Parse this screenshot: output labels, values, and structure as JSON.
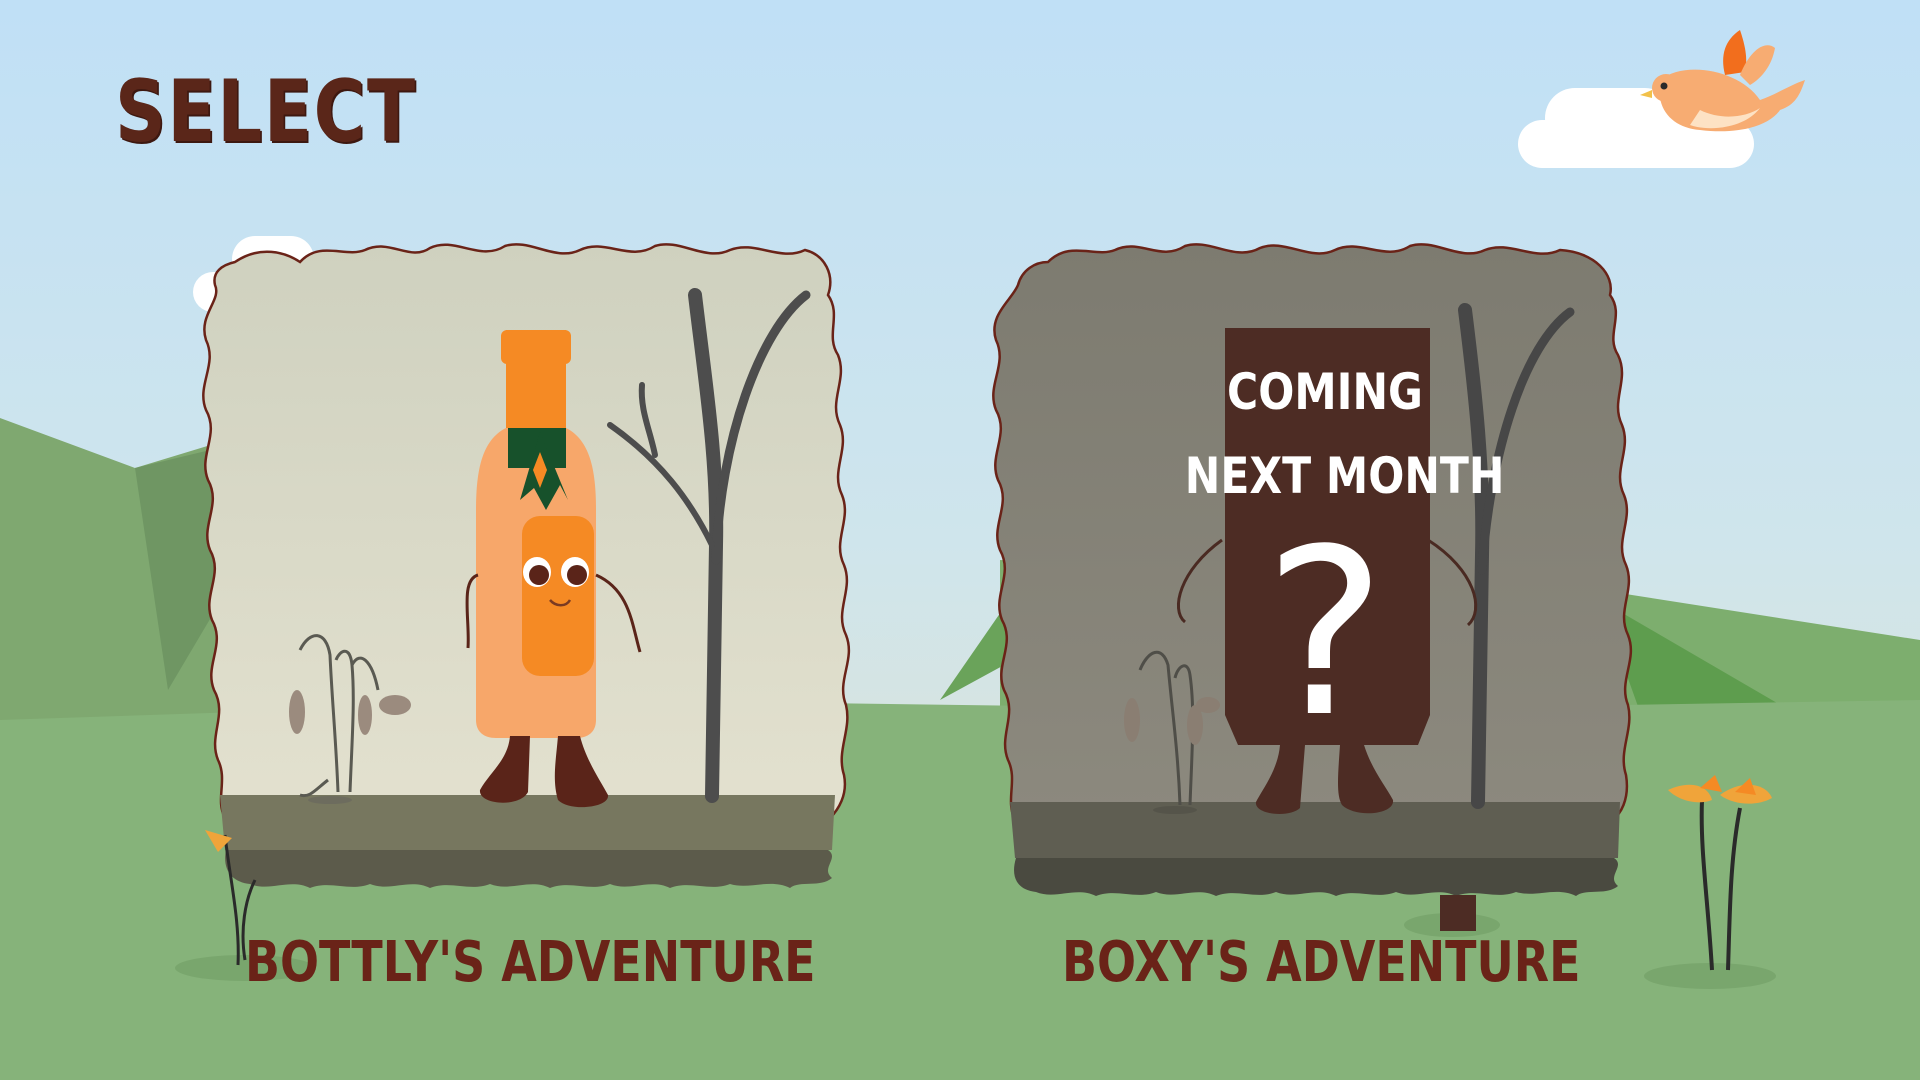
{
  "screen": {
    "title": "SELECT"
  },
  "cards": [
    {
      "label": "BOTTLY'S ADVENTURE",
      "locked": false
    },
    {
      "label": "BOXY'S ADVENTURE",
      "locked": true,
      "overlay_line1": "COMING",
      "overlay_line2": "NEXT MONTH",
      "overlay_symbol": "?"
    }
  ],
  "colors": {
    "sky_top": "#c2e2f4",
    "sky_bottom": "#d6e6e4",
    "grass": "#86b37a",
    "title_brown": "#5a2619",
    "card_border": "#6a2318",
    "bottle_orange": "#f4a66a",
    "bird_orange": "#f7ac72"
  },
  "icons": [
    "bird-icon",
    "cloud-icon",
    "bottle-character-icon",
    "box-character-icon",
    "dead-tree-icon",
    "wilted-flower-icon",
    "orange-flower-icon"
  ]
}
